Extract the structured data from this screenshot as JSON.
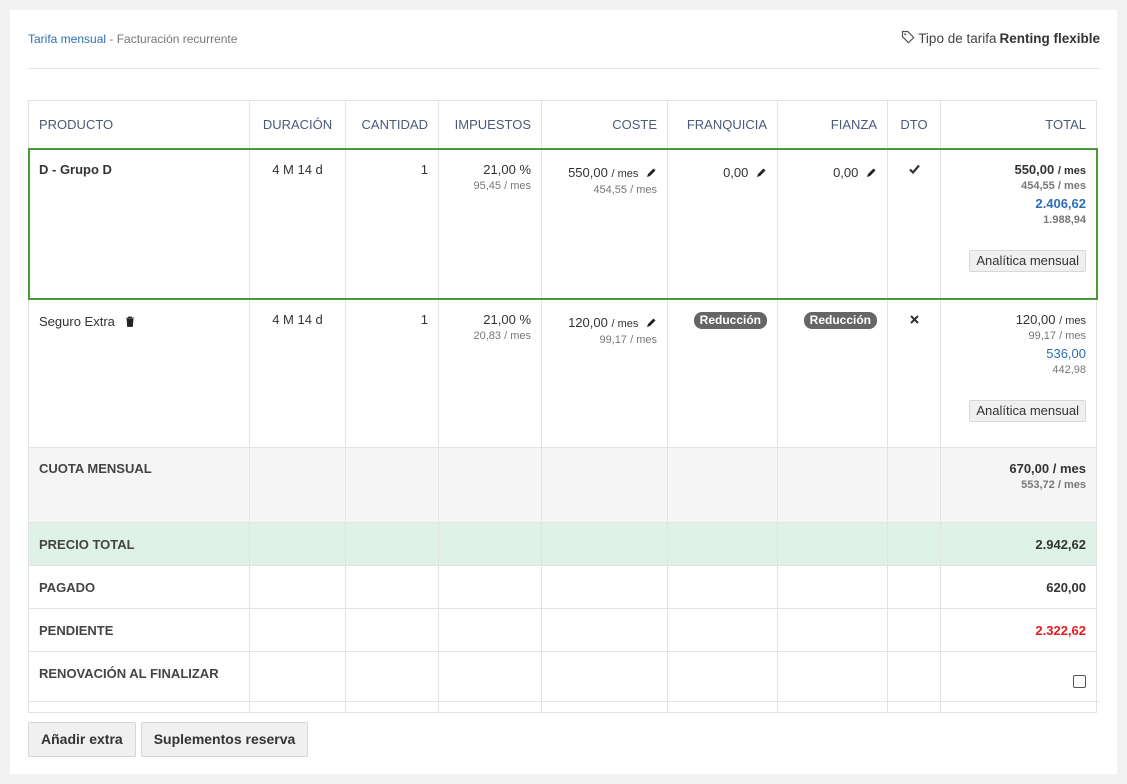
{
  "header": {
    "breadcrumb_link": "Tarifa mensual",
    "breadcrumb_sep": " - ",
    "breadcrumb_current": "Facturación recurrente",
    "rate_type_label": "Tipo de tarifa",
    "rate_type_value": "Renting flexible"
  },
  "table": {
    "columns": [
      "PRODUCTO",
      "DURACIÓN",
      "CANTIDAD",
      "IMPUESTOS",
      "COSTE",
      "FRANQUICIA",
      "FIANZA",
      "DTO",
      "TOTAL"
    ],
    "rows": [
      {
        "product": "D - Grupo D",
        "duration": "4 M 14 d",
        "quantity": "1",
        "tax": "21,00 %",
        "tax_sub": "95,45",
        "cost": "550,00",
        "cost_sub": "454,55",
        "franchise": "0,00",
        "deposit": "0,00",
        "discount_icon": "check-icon",
        "total": "550,00",
        "total_sub": "454,55",
        "total_full": "2.406,62",
        "total_full_sub": "1.988,94",
        "analytics_label": "Analítica mensual"
      },
      {
        "product": "Seguro Extra",
        "duration": "4 M 14 d",
        "quantity": "1",
        "tax": "21,00 %",
        "tax_sub": "20,83",
        "cost": "120,00",
        "cost_sub": "99,17",
        "franchise_badge": "Reducción",
        "deposit_badge": "Reducción",
        "discount_icon": "cross-icon",
        "total": "120,00",
        "total_sub": "99,17",
        "total_full": "536,00",
        "total_full_sub": "442,98",
        "analytics_label": "Analítica mensual"
      }
    ],
    "per_month": "/ mes",
    "summary": {
      "monthly_label": "CUOTA MENSUAL",
      "monthly_value": "670,00",
      "monthly_sub": "553,72",
      "total_label": "PRECIO TOTAL",
      "total_value": "2.942,62",
      "paid_label": "PAGADO",
      "paid_value": "620,00",
      "pending_label": "PENDIENTE",
      "pending_value": "2.322,62",
      "renew_label": "RENOVACIÓN AL FINALIZAR"
    }
  },
  "buttons": {
    "add_extra": "Añadir extra",
    "supplements": "Suplementos reserva"
  },
  "colors": {
    "link": "#2c6fb5",
    "highlight_border": "#4a9a3a",
    "total_row_bg": "#dff2e8",
    "pending": "#e01d1d"
  }
}
